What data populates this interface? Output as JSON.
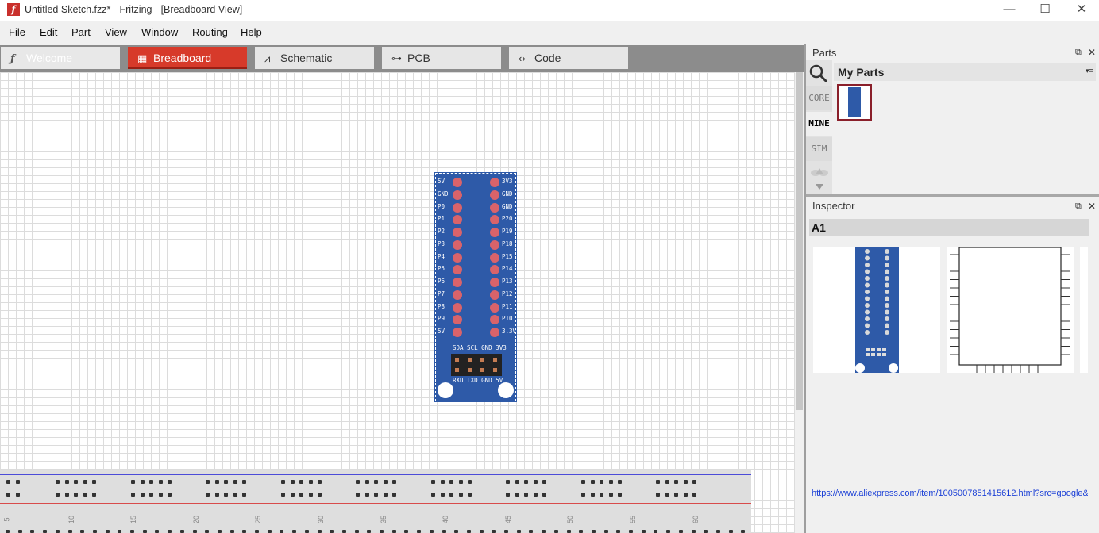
{
  "window": {
    "title": "Untitled Sketch.fzz* - Fritzing - [Breadboard View]",
    "app_icon_glyph": "f",
    "minimize_glyph": "—",
    "maximize_glyph": "☐",
    "close_glyph": "✕"
  },
  "menu": [
    "File",
    "Edit",
    "Part",
    "View",
    "Window",
    "Routing",
    "Help"
  ],
  "tabs": [
    {
      "label": "Welcome",
      "icon": "fritzing-f-icon",
      "glyph": "ƒ",
      "active": false
    },
    {
      "label": "Breadboard",
      "icon": "breadboard-icon",
      "glyph": "▦",
      "active": true
    },
    {
      "label": "Schematic",
      "icon": "resistor-icon",
      "glyph": "⩘",
      "active": false
    },
    {
      "label": "PCB",
      "icon": "pcb-icon",
      "glyph": "⊶",
      "active": false
    },
    {
      "label": "Code",
      "icon": "code-icon",
      "glyph": "‹›",
      "active": false
    }
  ],
  "part": {
    "left_labels": [
      "5V",
      "GND",
      "P0",
      "P1",
      "P2",
      "P3",
      "P4",
      "P5",
      "P6",
      "P7",
      "P8",
      "P9",
      "5V"
    ],
    "right_labels": [
      "3V3",
      "GND",
      "GND",
      "P20",
      "P19",
      "P18",
      "P15",
      "P14",
      "P13",
      "P12",
      "P11",
      "P10",
      "3.3V"
    ],
    "top_header_labels": "SDA SCL GND 3V3",
    "bottom_header_labels": "RXD TXD GND 5V"
  },
  "breadboard": {
    "numbers": [
      "5",
      "10",
      "15",
      "20",
      "25",
      "30",
      "35",
      "40",
      "45",
      "50",
      "55",
      "60"
    ]
  },
  "parts_panel": {
    "title": "Parts",
    "bin_title": "My Parts",
    "bins": [
      "CORE",
      "MINE",
      "SIM"
    ],
    "selected_bin": "MINE",
    "float_glyph": "⧉",
    "close_glyph": "✕",
    "menu_glyph": "▾≡"
  },
  "inspector": {
    "title": "Inspector",
    "part_name": "A1",
    "link": "https://www.aliexpress.com/item/1005007851415612.html?src=google&"
  },
  "colors": {
    "active_tab": "#d73a2a",
    "part_board": "#2e5aa8",
    "pin": "#d9636a",
    "link": "#1a3fd6"
  }
}
